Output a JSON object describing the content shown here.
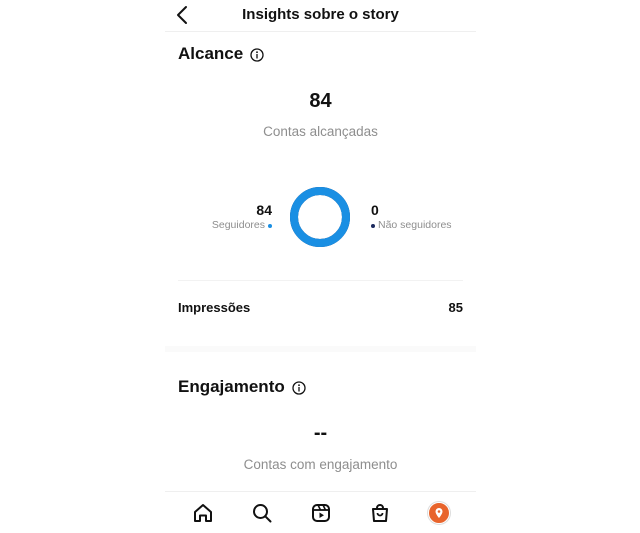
{
  "header": {
    "title": "Insights sobre o story"
  },
  "reach": {
    "title": "Alcance",
    "total": "84",
    "total_label": "Contas alcançadas",
    "followers_value": "84",
    "followers_label": "Seguidores",
    "non_followers_value": "0",
    "non_followers_label": "Não seguidores",
    "followers_fraction": 1.0,
    "followers_color": "#1a8fe3",
    "non_followers_color": "#1c2a5e"
  },
  "impressions": {
    "label": "Impressões",
    "value": "85"
  },
  "engagement": {
    "title": "Engajamento",
    "total": "--",
    "total_label": "Contas com engajamento"
  },
  "bottom_nav": {
    "items": [
      "home-icon",
      "search-icon",
      "reels-icon",
      "shop-icon",
      "profile-avatar"
    ]
  }
}
